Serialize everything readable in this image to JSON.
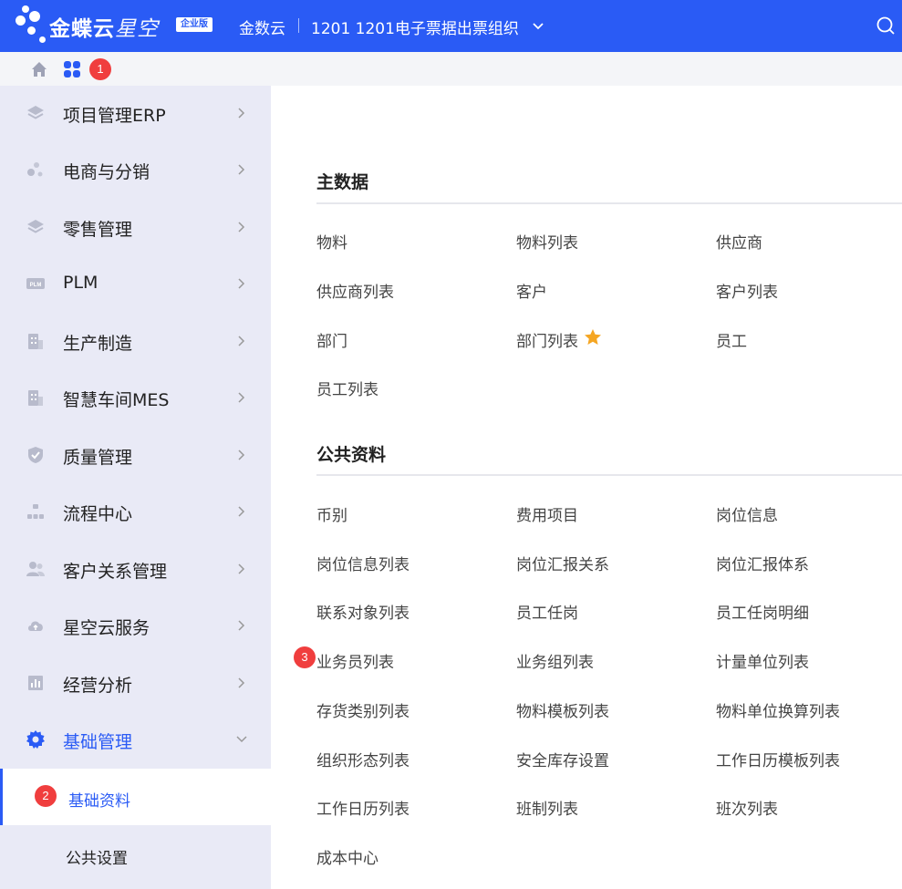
{
  "header": {
    "brand_bold": "金蝶云",
    "brand_light": "星空",
    "edition": "企业版",
    "company": "金数云",
    "org": "1201 1201电子票据出票组织"
  },
  "colors": {
    "accent": "#2a5bf5",
    "badge": "#f03e3e",
    "star": "#f5a623",
    "sidebar_bg": "#e9eaf6"
  },
  "badges": {
    "apps": "1",
    "base_data": "2",
    "sales_list": "3"
  },
  "sidebar": {
    "items": [
      {
        "label": "项目管理ERP",
        "icon": "layers-icon"
      },
      {
        "label": "电商与分销",
        "icon": "molecule-icon"
      },
      {
        "label": "零售管理",
        "icon": "layers-icon"
      },
      {
        "label": "PLM",
        "icon": "plm-icon"
      },
      {
        "label": "生产制造",
        "icon": "building-icon"
      },
      {
        "label": "智慧车间MES",
        "icon": "building-icon"
      },
      {
        "label": "质量管理",
        "icon": "shield-check-icon"
      },
      {
        "label": "流程中心",
        "icon": "flow-icon"
      },
      {
        "label": "客户关系管理",
        "icon": "users-icon"
      },
      {
        "label": "星空云服务",
        "icon": "cloud-icon"
      },
      {
        "label": "经营分析",
        "icon": "analytics-icon"
      },
      {
        "label": "基础管理",
        "icon": "gear-icon"
      }
    ],
    "sub_items": [
      {
        "label": "基础资料"
      },
      {
        "label": "公共设置"
      }
    ]
  },
  "main": {
    "sections": [
      {
        "title": "主数据",
        "links": [
          "物料",
          "物料列表",
          "供应商",
          "供应商列表",
          "客户",
          "客户列表",
          "部门",
          "部门列表",
          "员工",
          "员工列表"
        ]
      },
      {
        "title": "公共资料",
        "links": [
          "币别",
          "费用项目",
          "岗位信息",
          "岗位信息列表",
          "岗位汇报关系",
          "岗位汇报体系",
          "联系对象列表",
          "员工任岗",
          "员工任岗明细",
          "业务员列表",
          "业务组列表",
          "计量单位列表",
          "存货类别列表",
          "物料模板列表",
          "物料单位换算列表",
          "组织形态列表",
          "安全库存设置",
          "工作日历模板列表",
          "工作日历列表",
          "班制列表",
          "班次列表",
          "成本中心"
        ]
      }
    ]
  }
}
